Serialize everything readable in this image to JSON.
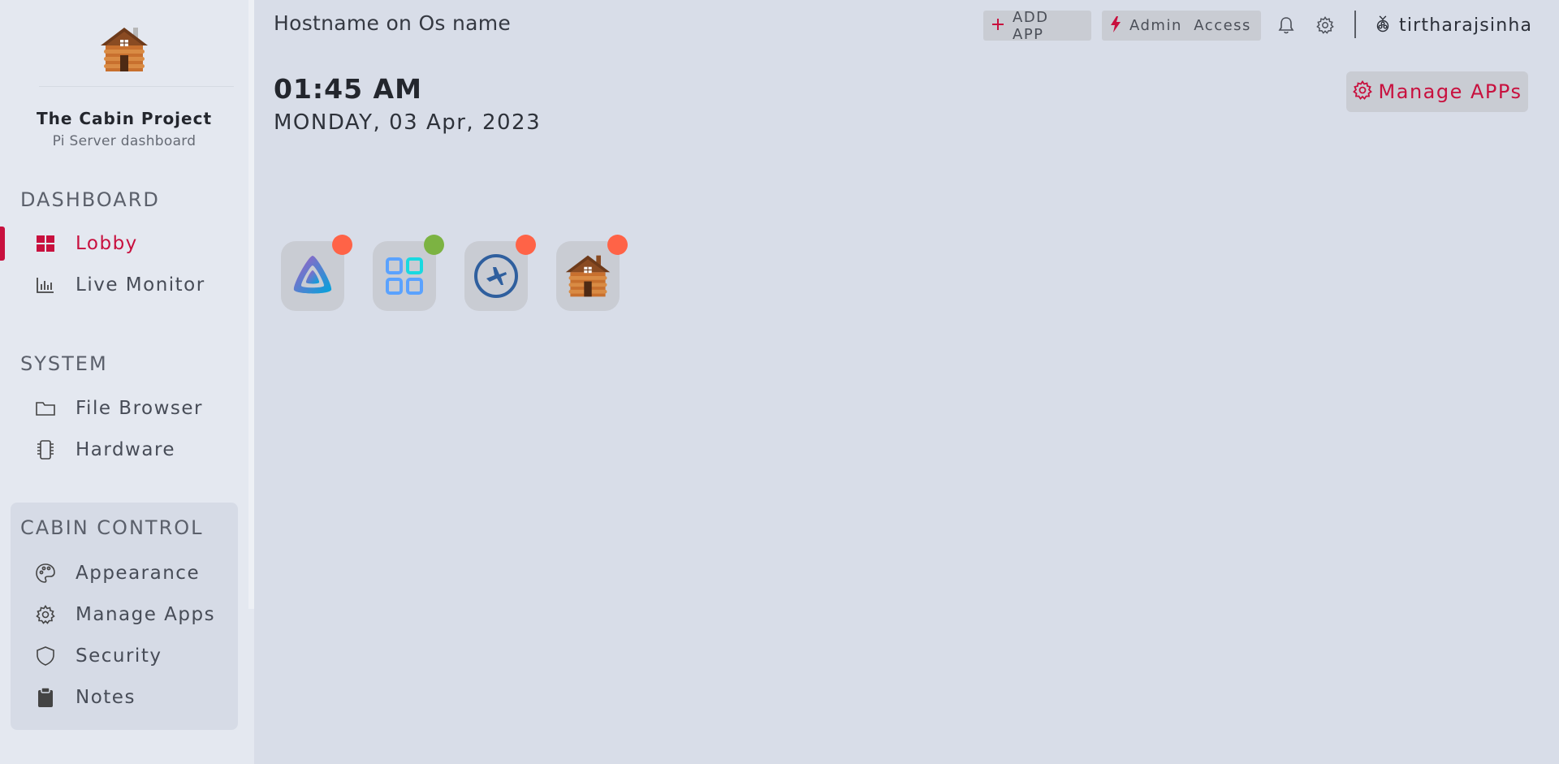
{
  "window": {
    "hostname_title": "Hostname on Os name"
  },
  "brand": {
    "name": "The Cabin Project",
    "subtitle": "Pi Server dashboard",
    "logo_icon": "cabin-icon"
  },
  "sidebar": {
    "sections": [
      {
        "title": "DASHBOARD",
        "items": [
          {
            "label": "Lobby",
            "icon": "grid-icon",
            "active": true
          },
          {
            "label": "Live Monitor",
            "icon": "bar-chart-icon",
            "active": false
          }
        ]
      },
      {
        "title": "SYSTEM",
        "items": [
          {
            "label": "File Browser",
            "icon": "folder-icon",
            "active": false
          },
          {
            "label": "Hardware",
            "icon": "chip-icon",
            "active": false
          }
        ]
      },
      {
        "title": "CABIN CONTROL",
        "items": [
          {
            "label": "Appearance",
            "icon": "palette-icon",
            "active": false
          },
          {
            "label": "Manage Apps",
            "icon": "gear-icon",
            "active": false
          },
          {
            "label": "Security",
            "icon": "shield-icon",
            "active": false
          },
          {
            "label": "Notes",
            "icon": "clipboard-icon",
            "active": false
          }
        ]
      }
    ]
  },
  "topbar": {
    "add_app_label": "ADD APP",
    "admin_label": "Admin  Access",
    "username": "tirtharajsinha"
  },
  "main": {
    "time": "01:45 AM",
    "date": "MONDAY, 03 Apr, 2023",
    "manage_apps_label": "Manage APPs"
  },
  "apps": [
    {
      "icon": "jellyfin-icon",
      "status": "stopped",
      "status_color": "#ff6347"
    },
    {
      "icon": "apps-grid-icon",
      "status": "running",
      "status_color": "#7cb342"
    },
    {
      "icon": "flight-compass-icon",
      "status": "stopped",
      "status_color": "#ff6347"
    },
    {
      "icon": "cabin-icon",
      "status": "stopped",
      "status_color": "#ff6347"
    }
  ],
  "colors": {
    "accent": "#c8103e",
    "background": "#d8dde8",
    "sidebar": "#e4e8f0"
  }
}
